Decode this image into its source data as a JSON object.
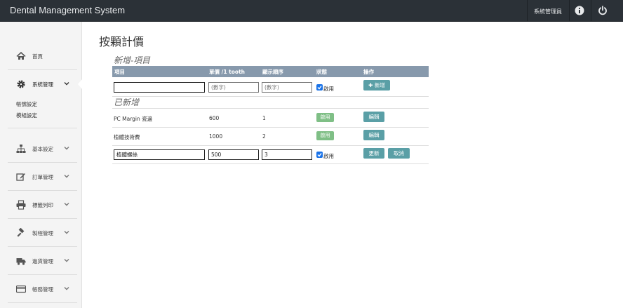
{
  "app": {
    "brand": "Dental Management System",
    "user_label": "系統管理員",
    "info_icon": "info-icon",
    "power_icon": "power-icon"
  },
  "sidebar": {
    "items": [
      {
        "label": "首頁",
        "icon": "home-icon"
      },
      {
        "label": "系統管理",
        "icon": "gear-icon",
        "expanded": true
      },
      {
        "label": "基本設定",
        "icon": "sitemap-icon"
      },
      {
        "label": "訂單管理",
        "icon": "edit-icon"
      },
      {
        "label": "標籤列印",
        "icon": "printer-icon"
      },
      {
        "label": "製程管理",
        "icon": "hammer-icon"
      },
      {
        "label": "進貨管理",
        "icon": "truck-icon"
      },
      {
        "label": "帳務管理",
        "icon": "credit-card-icon"
      }
    ],
    "sub_items": [
      "帳號設定",
      "模組設定"
    ]
  },
  "page": {
    "title": "按顆計價",
    "new_section": "新增-項目",
    "added_section": "已新增"
  },
  "table": {
    "headers": [
      "項目",
      "單價 /1 tooth",
      "顯示順序",
      "狀態",
      "操作"
    ],
    "new_row": {
      "item_value": "",
      "price_placeholder": "(數字)",
      "order_placeholder": "(數字)",
      "enable_label": "啟用",
      "add_button": "新增"
    },
    "rows": [
      {
        "item": "PC Margin 瓷邊",
        "price": "600",
        "order": "1",
        "status": "啟用",
        "action": "編輯"
      },
      {
        "item": "植體技術費",
        "price": "1000",
        "order": "2",
        "status": "啟用",
        "action": "編輯"
      }
    ],
    "edit_row": {
      "item_value": "植體螺絲",
      "price_value": "500",
      "order_value": "3",
      "enable_label": "啟用",
      "update_button": "更新",
      "cancel_button": "取消"
    }
  },
  "colors": {
    "topbar": "#2b3137",
    "header": "#8799ac",
    "button": "#5a9fa6",
    "badge": "#7fbf86",
    "checkbox": "#1a73e8"
  }
}
